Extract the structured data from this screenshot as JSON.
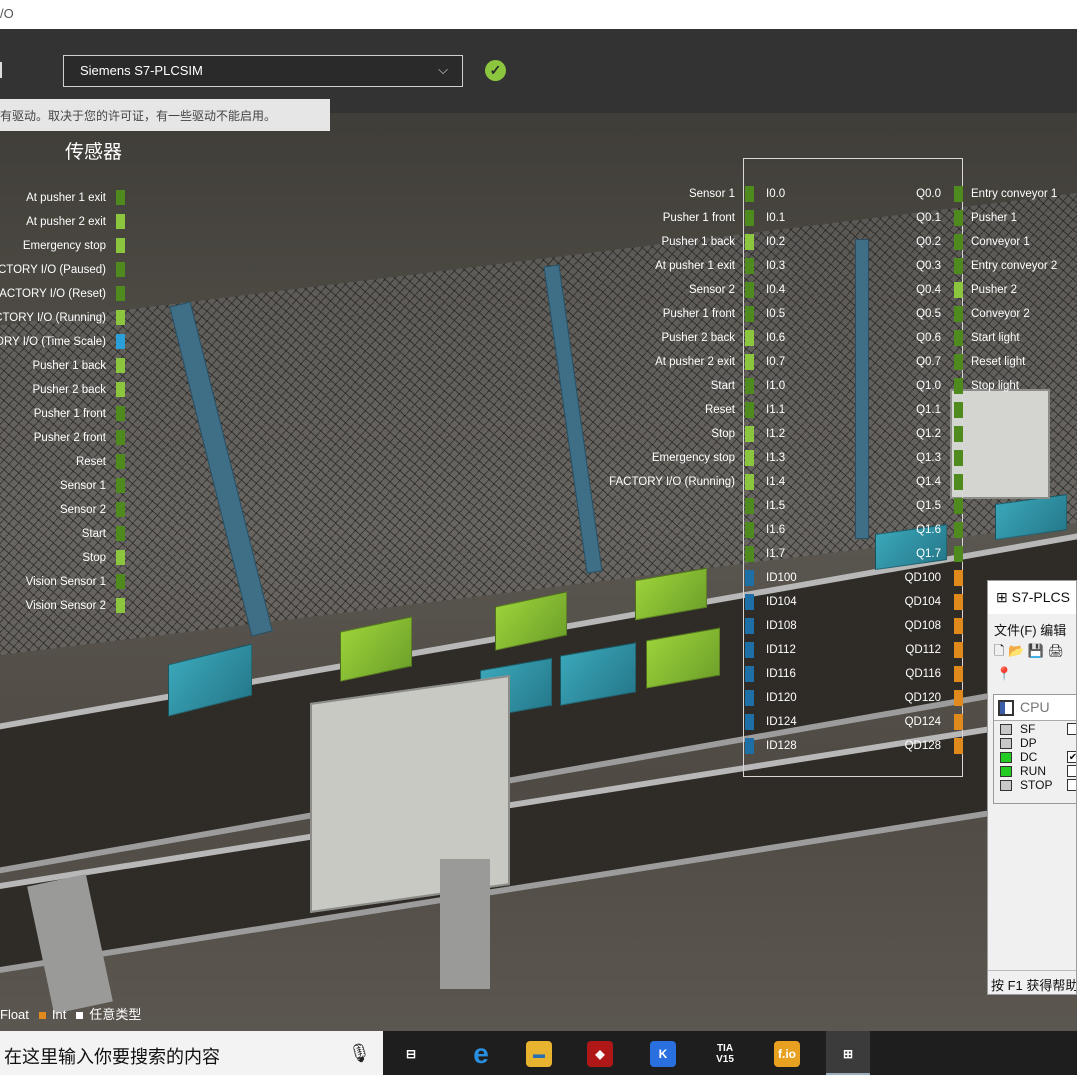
{
  "window": {
    "title_fragment": "/O"
  },
  "driver": {
    "selected": "Siemens S7-PLCSIM",
    "tooltip": "有驱动。取决于您的许可证，有一些驱动不能启用。"
  },
  "sensors_panel": {
    "title": "传感器",
    "items": [
      {
        "label": "At pusher 1 exit",
        "color": "#4f8a1e"
      },
      {
        "label": "At pusher 2 exit",
        "color": "#8cc63e"
      },
      {
        "label": "Emergency stop",
        "color": "#8cc63e"
      },
      {
        "label": "CTORY I/O (Paused)",
        "color": "#4f8a1e"
      },
      {
        "label": "FACTORY I/O (Reset)",
        "color": "#4f8a1e"
      },
      {
        "label": "CTORY I/O (Running)",
        "color": "#8cc63e"
      },
      {
        "label": "ORY I/O (Time Scale)",
        "color": "#2a9fd8"
      },
      {
        "label": "Pusher 1 back",
        "color": "#8cc63e"
      },
      {
        "label": "Pusher 2 back",
        "color": "#8cc63e"
      },
      {
        "label": "Pusher 1 front",
        "color": "#4f8a1e"
      },
      {
        "label": "Pusher 2 front",
        "color": "#4f8a1e"
      },
      {
        "label": "Reset",
        "color": "#4f8a1e"
      },
      {
        "label": "Sensor 1",
        "color": "#4f8a1e"
      },
      {
        "label": "Sensor 2",
        "color": "#4f8a1e"
      },
      {
        "label": "Start",
        "color": "#4f8a1e"
      },
      {
        "label": "Stop",
        "color": "#8cc63e"
      },
      {
        "label": "Vision Sensor 1",
        "color": "#4f8a1e"
      },
      {
        "label": "Vision Sensor 2",
        "color": "#8cc63e"
      }
    ]
  },
  "io_map": {
    "rows": [
      {
        "sensor": "Sensor 1",
        "s_color": "#4f8a1e",
        "input": "I0.0",
        "output": "Q0.0",
        "a_color": "#4f8a1e",
        "actuator": "Entry conveyor 1"
      },
      {
        "sensor": "Pusher 1 front",
        "s_color": "#4f8a1e",
        "input": "I0.1",
        "output": "Q0.1",
        "a_color": "#4f8a1e",
        "actuator": "Pusher 1"
      },
      {
        "sensor": "Pusher 1 back",
        "s_color": "#8cc63e",
        "input": "I0.2",
        "output": "Q0.2",
        "a_color": "#4f8a1e",
        "actuator": "Conveyor 1"
      },
      {
        "sensor": "At pusher 1 exit",
        "s_color": "#4f8a1e",
        "input": "I0.3",
        "output": "Q0.3",
        "a_color": "#4f8a1e",
        "actuator": "Entry conveyor 2"
      },
      {
        "sensor": "Sensor 2",
        "s_color": "#4f8a1e",
        "input": "I0.4",
        "output": "Q0.4",
        "a_color": "#8cc63e",
        "actuator": "Pusher 2"
      },
      {
        "sensor": "Pusher 1 front",
        "s_color": "#4f8a1e",
        "input": "I0.5",
        "output": "Q0.5",
        "a_color": "#4f8a1e",
        "actuator": "Conveyor 2"
      },
      {
        "sensor": "Pusher 2 back",
        "s_color": "#8cc63e",
        "input": "I0.6",
        "output": "Q0.6",
        "a_color": "#4f8a1e",
        "actuator": "Start light"
      },
      {
        "sensor": "At pusher 2 exit",
        "s_color": "#8cc63e",
        "input": "I0.7",
        "output": "Q0.7",
        "a_color": "#4f8a1e",
        "actuator": "Reset light"
      },
      {
        "sensor": "Start",
        "s_color": "#4f8a1e",
        "input": "I1.0",
        "output": "Q1.0",
        "a_color": "#4f8a1e",
        "actuator": "Stop light"
      },
      {
        "sensor": "Reset",
        "s_color": "#4f8a1e",
        "input": "I1.1",
        "output": "Q1.1",
        "a_color": "#4f8a1e",
        "actuator": ""
      },
      {
        "sensor": "Stop",
        "s_color": "#8cc63e",
        "input": "I1.2",
        "output": "Q1.2",
        "a_color": "#4f8a1e",
        "actuator": ""
      },
      {
        "sensor": "Emergency stop",
        "s_color": "#8cc63e",
        "input": "I1.3",
        "output": "Q1.3",
        "a_color": "#4f8a1e",
        "actuator": ""
      },
      {
        "sensor": "FACTORY I/O (Running)",
        "s_color": "#8cc63e",
        "input": "I1.4",
        "output": "Q1.4",
        "a_color": "#4f8a1e",
        "actuator": ""
      },
      {
        "sensor": "",
        "s_color": "#4f8a1e",
        "input": "I1.5",
        "output": "Q1.5",
        "a_color": "#4f8a1e",
        "actuator": ""
      },
      {
        "sensor": "",
        "s_color": "#4f8a1e",
        "input": "I1.6",
        "output": "Q1.6",
        "a_color": "#4f8a1e",
        "actuator": ""
      },
      {
        "sensor": "",
        "s_color": "#4f8a1e",
        "input": "I1.7",
        "output": "Q1.7",
        "a_color": "#4f8a1e",
        "actuator": ""
      },
      {
        "sensor": "",
        "s_color": "#1e6fa6",
        "input": "ID100",
        "output": "QD100",
        "a_color": "#e08a1e",
        "actuator": ""
      },
      {
        "sensor": "",
        "s_color": "#1e6fa6",
        "input": "ID104",
        "output": "QD104",
        "a_color": "#e08a1e",
        "actuator": ""
      },
      {
        "sensor": "",
        "s_color": "#1e6fa6",
        "input": "ID108",
        "output": "QD108",
        "a_color": "#e08a1e",
        "actuator": ""
      },
      {
        "sensor": "",
        "s_color": "#1e6fa6",
        "input": "ID112",
        "output": "QD112",
        "a_color": "#e08a1e",
        "actuator": ""
      },
      {
        "sensor": "",
        "s_color": "#1e6fa6",
        "input": "ID116",
        "output": "QD116",
        "a_color": "#e08a1e",
        "actuator": ""
      },
      {
        "sensor": "",
        "s_color": "#1e6fa6",
        "input": "ID120",
        "output": "QD120",
        "a_color": "#e08a1e",
        "actuator": ""
      },
      {
        "sensor": "",
        "s_color": "#1e6fa6",
        "input": "ID124",
        "output": "QD124",
        "a_color": "#e08a1e",
        "actuator": ""
      },
      {
        "sensor": "",
        "s_color": "#1e6fa6",
        "input": "ID128",
        "output": "QD128",
        "a_color": "#e08a1e",
        "actuator": ""
      }
    ]
  },
  "legend": {
    "items": [
      {
        "label": "Float",
        "color": "#2a9fd8"
      },
      {
        "label": "Int",
        "color": "#e08a1e"
      },
      {
        "label": "任意类型",
        "color": "#ffffff"
      }
    ]
  },
  "plcsim": {
    "title": "S7-PLCS",
    "menu": "文件(F)  编辑",
    "toolbar": "🗋 📂 💾 🖨",
    "cpu_label": "CPU",
    "leds": [
      {
        "label": "SF",
        "color": "#c8c8c8",
        "checkbox": ""
      },
      {
        "label": "DP",
        "color": "#c8c8c8",
        "checkbox": ""
      },
      {
        "label": "DC",
        "color": "#22cc22",
        "checkbox": "✔"
      },
      {
        "label": "RUN",
        "color": "#22cc22",
        "checkbox": ""
      },
      {
        "label": "STOP",
        "color": "#c8c8c8",
        "checkbox": ""
      }
    ],
    "status": "按 F1 获得帮助"
  },
  "taskbar": {
    "search_placeholder": "在这里输入你要搜索的内容",
    "apps": [
      {
        "name": "task-view",
        "glyph": "⊟",
        "bg": "#1e1e1e",
        "fg": "#ffffff"
      },
      {
        "name": "edge",
        "glyph": "e",
        "bg": "#1e1e1e",
        "fg": "#2a8fe0"
      },
      {
        "name": "file-explorer",
        "glyph": "▬",
        "bg": "#e8b430",
        "fg": "#2a6fb0"
      },
      {
        "name": "red-app",
        "glyph": "◆",
        "bg": "#b01818",
        "fg": "#ffffff"
      },
      {
        "name": "k-app",
        "glyph": "K",
        "bg": "#2a6fe0",
        "fg": "#ffffff"
      },
      {
        "name": "tia-portal",
        "glyph": "TIA V15",
        "bg": "#1e1e1e",
        "fg": "#ffffff"
      },
      {
        "name": "factory-io",
        "glyph": "f.io",
        "bg": "#e8a020",
        "fg": "#ffffff"
      },
      {
        "name": "s7-plcsim",
        "glyph": "⊞",
        "bg": "#3b3b3b",
        "fg": "#ffffff"
      }
    ]
  }
}
